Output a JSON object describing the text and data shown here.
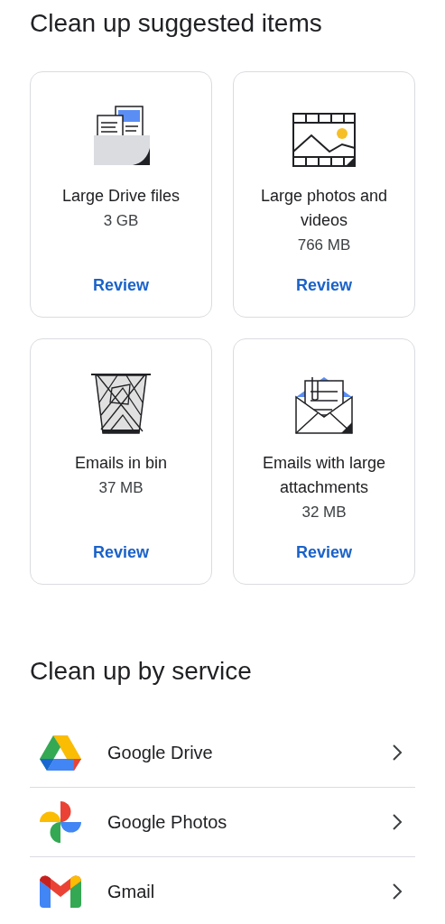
{
  "suggested": {
    "title": "Clean up suggested items",
    "cards": [
      {
        "kind": "files",
        "name": "Large Drive files",
        "size": "3 GB",
        "action": "Review"
      },
      {
        "kind": "photos",
        "name": "Large photos and videos",
        "size": "766 MB",
        "action": "Review"
      },
      {
        "kind": "bin",
        "name": "Emails in bin",
        "size": "37 MB",
        "action": "Review"
      },
      {
        "kind": "attachments",
        "name": "Emails with large attachments",
        "size": "32 MB",
        "action": "Review"
      }
    ]
  },
  "services": {
    "title": "Clean up by service",
    "items": [
      {
        "kind": "drive",
        "label": "Google Drive"
      },
      {
        "kind": "photos",
        "label": "Google Photos"
      },
      {
        "kind": "gmail",
        "label": "Gmail"
      }
    ]
  }
}
